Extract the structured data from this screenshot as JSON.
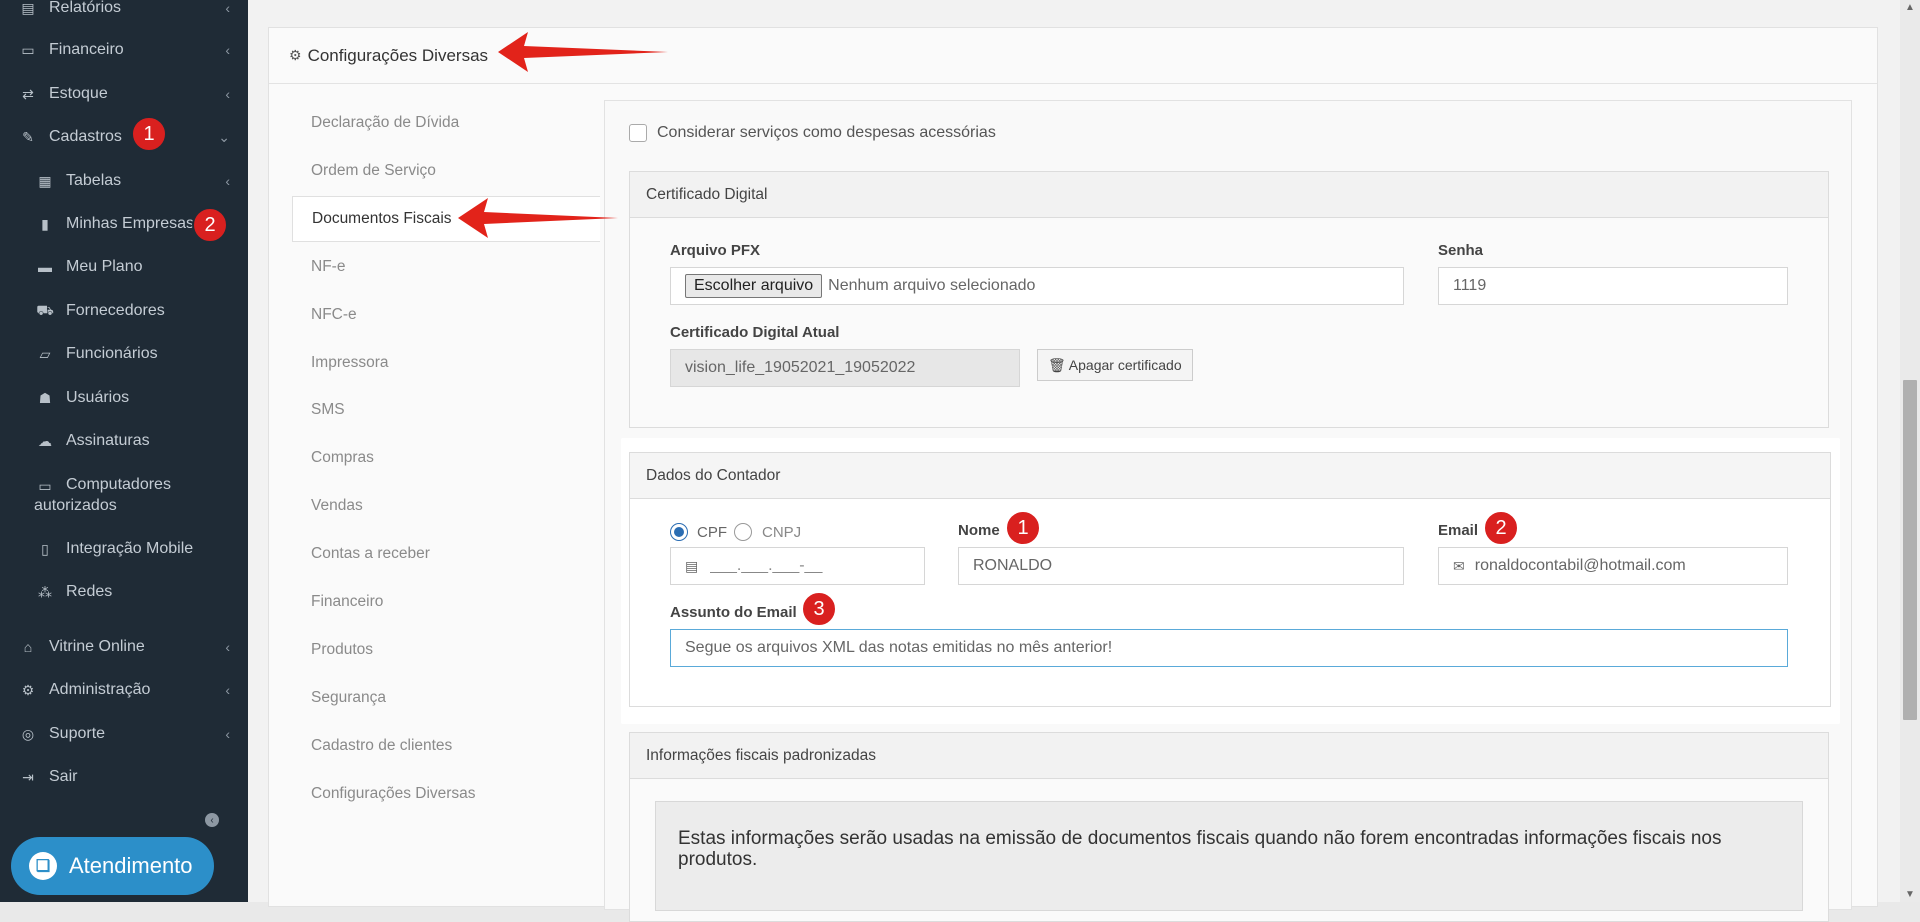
{
  "sidebar": {
    "items": [
      {
        "label": "Relatórios",
        "icon": "report-icon",
        "chevron": "‹"
      },
      {
        "label": "Financeiro",
        "icon": "money-icon",
        "chevron": "‹"
      },
      {
        "label": "Estoque",
        "icon": "exchange-icon",
        "chevron": "‹"
      },
      {
        "label": "Cadastros",
        "icon": "edit-icon",
        "chevron": "⌄"
      },
      {
        "label": "Tabelas",
        "icon": "table-icon",
        "chevron": "‹"
      },
      {
        "label": "Minhas Empresas",
        "icon": "building-icon"
      },
      {
        "label": "Meu Plano",
        "icon": "book-icon"
      },
      {
        "label": "Fornecedores",
        "icon": "truck-icon"
      },
      {
        "label": "Funcionários",
        "icon": "folder-icon"
      },
      {
        "label": "Usuários",
        "icon": "users-icon"
      },
      {
        "label": "Assinaturas",
        "icon": "cloud-icon"
      },
      {
        "label": "Computadores autorizados",
        "icon": "desktop-icon"
      },
      {
        "label": "Integração Mobile",
        "icon": "mobile-icon"
      },
      {
        "label": "Redes",
        "icon": "network-icon"
      },
      {
        "label": "Vitrine Online",
        "icon": "shop-icon",
        "chevron": "‹"
      },
      {
        "label": "Administração",
        "icon": "gears-icon",
        "chevron": "‹"
      },
      {
        "label": "Suporte",
        "icon": "support-icon",
        "chevron": "‹"
      },
      {
        "label": "Sair",
        "icon": "logout-icon"
      }
    ],
    "badge_cadastros": "1",
    "badge_empresas": "2",
    "support_button": "Atendimento"
  },
  "panel": {
    "title": "Configurações Diversas",
    "menu": [
      "Declaração de Dívida",
      "Ordem de Serviço",
      "Documentos Fiscais",
      "NF-e",
      "NFC-e",
      "Impressora",
      "SMS",
      "Compras",
      "Vendas",
      "Contas a receber",
      "Financeiro",
      "Produtos",
      "Segurança",
      "Cadastro de clientes",
      "Configurações Diversas"
    ],
    "active_menu": "Documentos Fiscais"
  },
  "content": {
    "checkbox_label": "Considerar serviços como despesas acessórias",
    "certificado": {
      "title": "Certificado Digital",
      "pfx_label": "Arquivo PFX",
      "file_button": "Escolher arquivo",
      "file_status": "Nenhum arquivo selecionado",
      "senha_label": "Senha",
      "senha_value": "1119",
      "atual_label": "Certificado Digital Atual",
      "atual_value": "vision_life_19052021_19052022",
      "delete_button": "Apagar certificado"
    },
    "contador": {
      "title": "Dados do Contador",
      "cpf_label": "CPF",
      "cnpj_label": "CNPJ",
      "doc_placeholder": "___.___.___-__",
      "nome_label": "Nome",
      "nome_value": "RONALDO",
      "email_label": "Email",
      "email_value": "ronaldocontabil@hotmail.com",
      "assunto_label": "Assunto do Email",
      "assunto_value": "Segue os arquivos XML das notas emitidas no mês anterior!",
      "badge_nome": "1",
      "badge_email": "2",
      "badge_assunto": "3"
    },
    "info_fiscais": {
      "title": "Informações fiscais padronizadas",
      "text": "Estas informações serão usadas na emissão de documentos fiscais quando não forem encontradas informações fiscais nos produtos."
    }
  },
  "colors": {
    "sidebar_bg": "#1f2b36",
    "badge_red": "#d9201f",
    "support_blue": "#2c8fc9",
    "radio_blue": "#2a6db3"
  }
}
